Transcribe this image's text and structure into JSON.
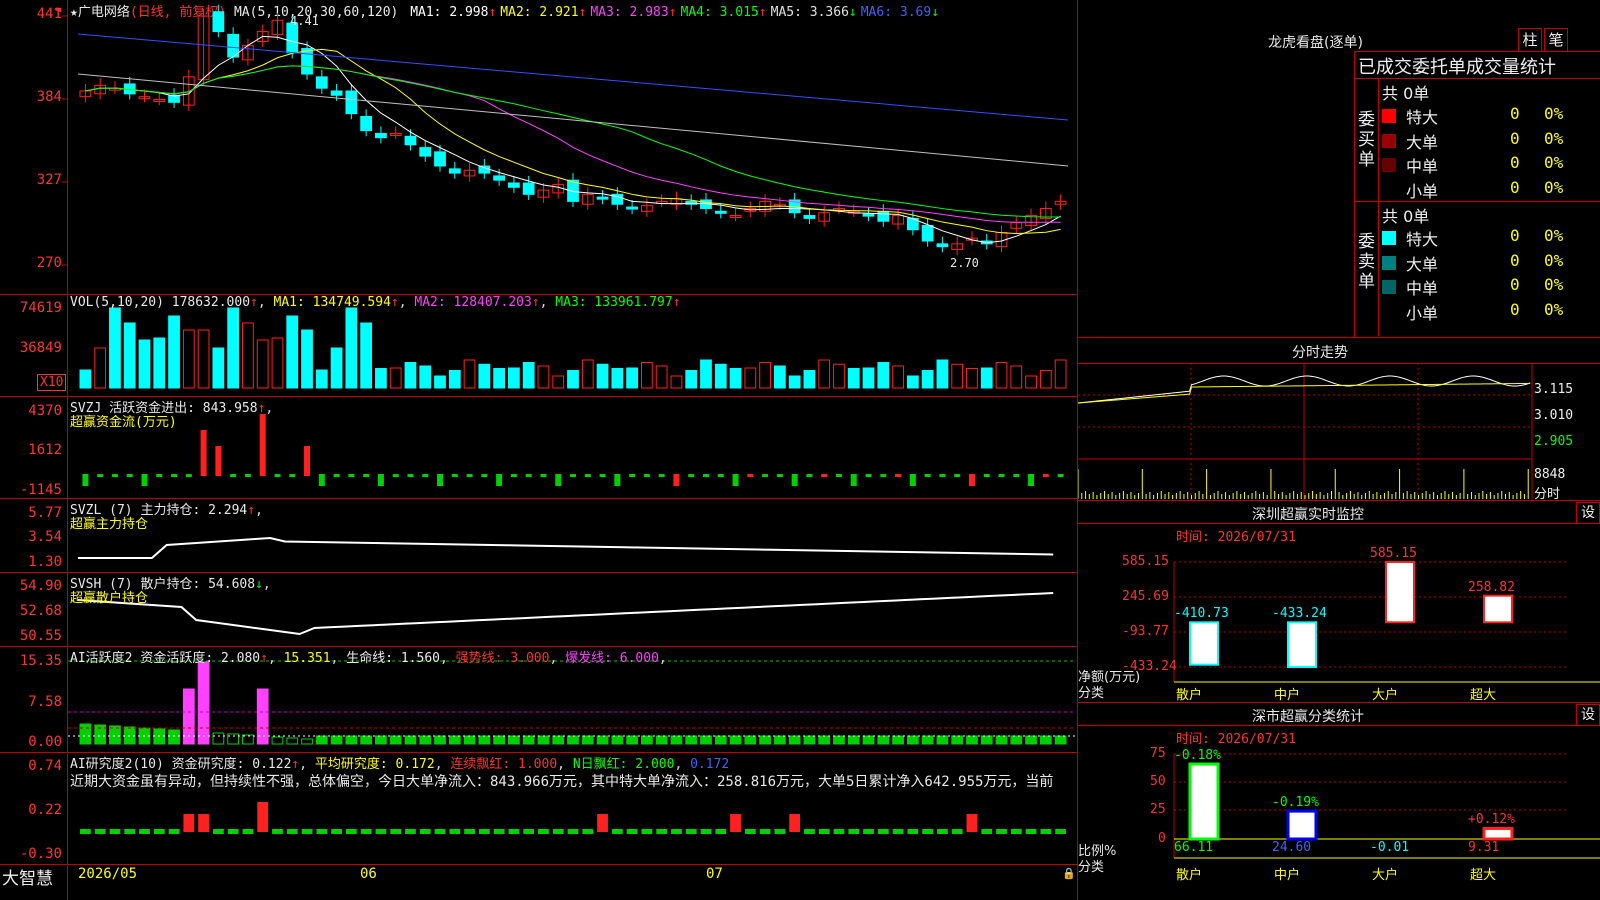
{
  "title_bar": {
    "star": "★",
    "stock_name": "广电网络",
    "period": "(日线, 前复权)"
  },
  "ma_line": {
    "label": "MA(5,10,20,30,60,120)",
    "items": [
      {
        "text": "MA1: 2.998",
        "arrow": "↑",
        "color": "#ffffff"
      },
      {
        "text": "MA2: 2.921",
        "arrow": "↑",
        "color": "#ffff00"
      },
      {
        "text": "MA3: 2.983",
        "arrow": "↑",
        "color": "#ff40ff"
      },
      {
        "text": "MA4: 3.015",
        "arrow": "↑",
        "color": "#00ff00"
      },
      {
        "text": "MA5: 3.366",
        "arrow": "↓",
        "color": "#e0e0e0"
      },
      {
        "text": "MA6: 3.69",
        "arrow": "↓",
        "color": "#4060ff"
      }
    ]
  },
  "price_axis": [
    "441",
    "384",
    "327",
    "270"
  ],
  "price_annotations": {
    "high": "4.41",
    "low": "2.70"
  },
  "vol_panel": {
    "label": "VOL(5,10,20)",
    "value": "178632.000",
    "ma1": "MA1: 134749.594",
    "ma2": "MA2: 128407.203",
    "ma3": "MA3: 133961.797",
    "axis": [
      "74619",
      "36849"
    ],
    "unit": "X10"
  },
  "svzj_panel": {
    "label": "SVZJ",
    "title": "活跃资金进出: 843.958",
    "subtitle": "超赢资金流(万元)",
    "axis": [
      "4370",
      "1612",
      "-1145"
    ]
  },
  "svzl_panel": {
    "label": "SVZL (7)",
    "title": "主力持仓: 2.294",
    "subtitle": "超赢主力持仓",
    "axis": [
      "5.77",
      "3.54",
      "1.30"
    ]
  },
  "svsh_panel": {
    "label": "SVSH (7)",
    "title": "散户持仓: 54.608",
    "subtitle": "超赢散户持仓",
    "axis": [
      "54.90",
      "52.68",
      "50.55"
    ]
  },
  "ai_panel": {
    "label": "AI活跃度2",
    "t1": "资金活跃度: 2.080",
    "t2": "15.351",
    "t3": "生命线: 1.560",
    "t4": "强势线: 3.000",
    "t5": "爆发线: 6.000",
    "axis": [
      "15.35",
      "7.58",
      "0.00"
    ]
  },
  "research_panel": {
    "label": "AI研究度2(10)",
    "t1": "资金研究度: 0.122",
    "t2": "平均研究度: 0.172",
    "t3": "连续飘红: 1.000",
    "t4": "N日飘红: 2.000",
    "t5": "0.172",
    "note": "近期大资金虽有异动，但持续性不强，总体偏空，今日大单净流入：843.966万元，其中特大单净流入：258.816万元，大单5日累计净入642.955万元，当前",
    "axis": [
      "0.74",
      "0.22",
      "-0.30"
    ]
  },
  "date_axis": [
    "2026/05",
    "06",
    "07"
  ],
  "brand": "大智慧",
  "longhu": {
    "title": "龙虎看盘(逐单)",
    "btn_zhu": "柱",
    "btn_bi": "笔",
    "header": "已成交委托单成交量统计",
    "buy_label": "委买单",
    "sell_label": "委卖单",
    "buy_total": "共 0单",
    "sell_total": "共 0单",
    "buy_rows": [
      {
        "name": "特大",
        "count": "0",
        "pct": "0%",
        "color": "#ff0000"
      },
      {
        "name": "大单",
        "count": "0",
        "pct": "0%",
        "color": "#990000"
      },
      {
        "name": "中单",
        "count": "0",
        "pct": "0%",
        "color": "#660000"
      },
      {
        "name": "小单",
        "count": "0",
        "pct": "0%",
        "color": ""
      }
    ],
    "sell_rows": [
      {
        "name": "特大",
        "count": "0",
        "pct": "0%",
        "color": "#00ffff"
      },
      {
        "name": "大单",
        "count": "0",
        "pct": "0%",
        "color": "#008080"
      },
      {
        "name": "中单",
        "count": "0",
        "pct": "0%",
        "color": "#006666"
      },
      {
        "name": "小单",
        "count": "0",
        "pct": "0%",
        "color": ""
      }
    ]
  },
  "intraday": {
    "title": "分时走势",
    "axis": [
      "3.115",
      "3.010",
      "2.905"
    ],
    "vol_value": "8848",
    "vol_label": "分时"
  },
  "monitor": {
    "title": "深圳超赢实时监控",
    "btn": "设",
    "time": "时间: 2026/07/31",
    "axis": [
      "585.15",
      "245.69",
      "-93.77",
      "-433.24"
    ],
    "ylabel1": "净额(万元)",
    "ylabel2": "分类",
    "bars": [
      {
        "cat": "散户",
        "value": -410.73,
        "label": "-410.73"
      },
      {
        "cat": "中户",
        "value": -433.24,
        "label": "-433.24"
      },
      {
        "cat": "大户",
        "value": 585.15,
        "label": "585.15"
      },
      {
        "cat": "超大",
        "value": 258.82,
        "label": "258.82"
      }
    ]
  },
  "classify": {
    "title": "深市超赢分类统计",
    "btn": "设",
    "time": "时间: 2026/07/31",
    "axis": [
      "75",
      "50",
      "25",
      "0"
    ],
    "ylabel1": "比例%",
    "ylabel2": "分类",
    "bars": [
      {
        "cat": "散户",
        "value": 66.11,
        "label": "66.11",
        "delta": "-0.18%"
      },
      {
        "cat": "中户",
        "value": 24.6,
        "label": "24.60",
        "delta": "-0.19%"
      },
      {
        "cat": "大户",
        "value": -0.01,
        "label": "-0.01",
        "delta": ""
      },
      {
        "cat": "超大",
        "value": 9.31,
        "label": "9.31",
        "delta": "+0.12%"
      }
    ]
  },
  "colors": {
    "up": "#ff2020",
    "down": "#00ffff",
    "grid": "#c00000"
  }
}
